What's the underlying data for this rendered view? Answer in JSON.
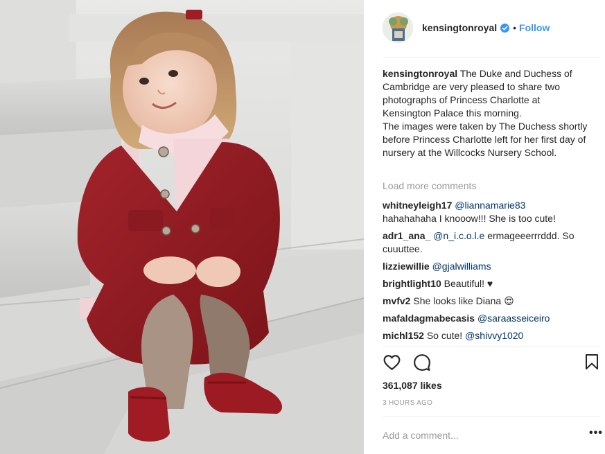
{
  "post": {
    "username": "kensingtonroyal",
    "follow_label": "Follow",
    "dot": "•",
    "caption_username": "kensingtonroyal",
    "caption_line1": "The Duke and Duchess of Cambridge are very pleased to share two photographs of Princess Charlotte at Kensington Palace this morning.",
    "caption_line2": "The images were taken by The Duchess shortly before Princess Charlotte left for her first day of nursery at the Willcocks Nursery School.",
    "load_more": "Load more comments",
    "likes": "361,087 likes",
    "time": "3 HOURS AGO",
    "add_comment_placeholder": "Add a comment...",
    "more_options": "•••"
  },
  "comments": [
    {
      "user": "whitneyleigh17",
      "mention": "@liannamarie83",
      "text": ""
    },
    {
      "user": "",
      "mention": "",
      "text": "hahahahaha I knooow!!! She is too cute!"
    },
    {
      "user": "adr1_ana_",
      "mention": "@n_i.c.o.l.e",
      "text": " ermageeerrrddd. So cuuuttee."
    },
    {
      "user": "lizziewillie",
      "mention": "@gjalwilliams",
      "text": ""
    },
    {
      "user": "brightlight10",
      "mention": "",
      "text": "Beautiful! ♥"
    },
    {
      "user": "mvfv2",
      "mention": "",
      "text": "She looks like Diana 😍"
    },
    {
      "user": "mafaldagmabecasis",
      "mention": "@saraasseiceiro",
      "text": ""
    },
    {
      "user": "michl152",
      "mention": "@shivvy1020",
      "text": "So cute! "
    }
  ],
  "colors": {
    "accent": "#3897f0",
    "mention": "#003569",
    "muted": "#999999",
    "text": "#262626",
    "coat": "#8e1b22"
  },
  "icons": [
    "verified-badge-icon",
    "heart-icon",
    "comment-icon",
    "bookmark-icon"
  ]
}
